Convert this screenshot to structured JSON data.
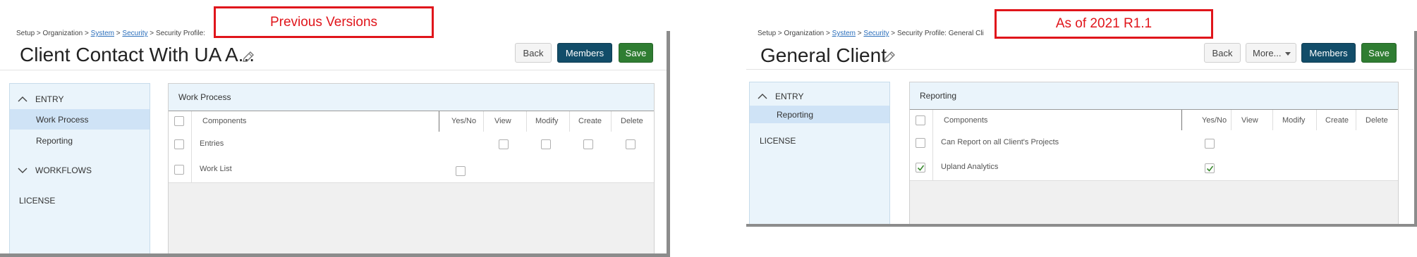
{
  "left": {
    "breadcrumb": {
      "setup": "Setup",
      "organization": "Organization",
      "system": "System",
      "security": "Security",
      "profile_prefix": "Security Profile:"
    },
    "title": "Client Contact With UA A...",
    "buttons": {
      "back": "Back",
      "members": "Members",
      "save": "Save"
    },
    "sidebar": {
      "entry": "ENTRY",
      "items": [
        "Work Process",
        "Reporting"
      ],
      "workflows": "WORKFLOWS",
      "license": "LICENSE"
    },
    "section_title": "Work Process",
    "columns": [
      "Components",
      "Yes/No",
      "View",
      "Modify",
      "Create",
      "Delete"
    ],
    "rows": [
      {
        "name": "Entries",
        "checked": [
          false,
          false,
          false,
          false
        ]
      },
      {
        "name": "Work List",
        "yesno": false
      }
    ]
  },
  "right": {
    "breadcrumb": {
      "setup": "Setup",
      "organization": "Organization",
      "system": "System",
      "security": "Security",
      "profile_prefix": "Security Profile: General Cli"
    },
    "title": "General Client",
    "buttons": {
      "back": "Back",
      "more": "More...",
      "members": "Members",
      "save": "Save"
    },
    "sidebar": {
      "entry": "ENTRY",
      "items": [
        "Reporting"
      ],
      "license": "LICENSE"
    },
    "section_title": "Reporting",
    "columns": [
      "Components",
      "Yes/No",
      "View",
      "Modify",
      "Create",
      "Delete"
    ],
    "rows": [
      {
        "name": "Can Report on all Client's Projects",
        "checked": false
      },
      {
        "name": "Upland Analytics",
        "checked": true
      }
    ]
  },
  "labels": {
    "previous": "Previous Versions",
    "current": "As of 2021 R1.1"
  },
  "colors": {
    "accent_red": "#e0151b",
    "navy": "#124d69",
    "green": "#2f7d32",
    "sidebar_bg": "#eaf4fb",
    "selected_bg": "#cfe3f6"
  }
}
